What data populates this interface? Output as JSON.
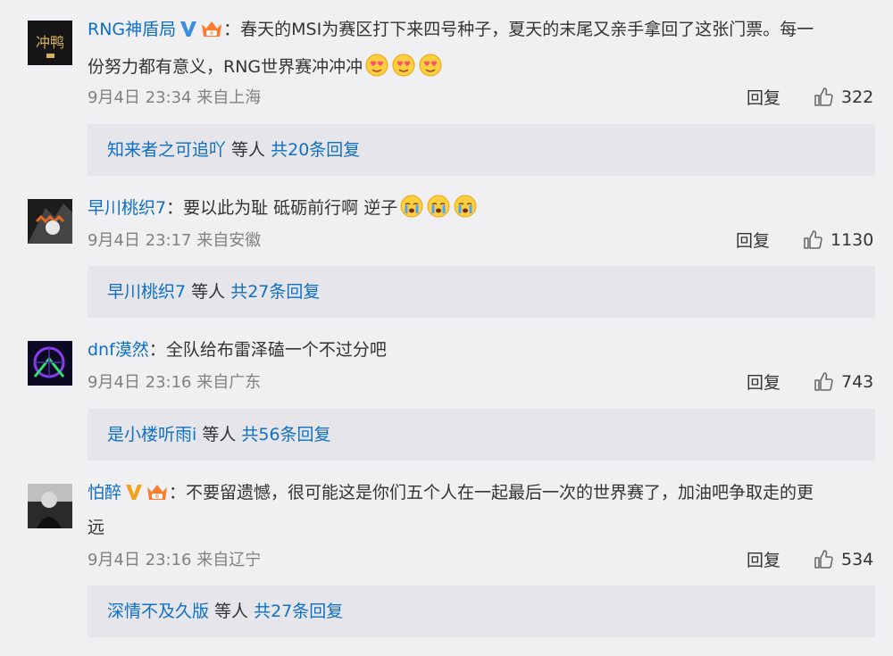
{
  "colors": {
    "link": "#0e6fc4",
    "text": "#333333",
    "meta": "#808080",
    "background": "#f0f0f3",
    "reply_box": "#e6e6ea"
  },
  "comments": [
    {
      "username": "RNG神盾局",
      "badges": [
        "verified-v-blue-icon",
        "crown-badge-icon"
      ],
      "separator": "：",
      "text_line1": "春天的MSI为赛区打下来四号种子，夏天的末尾又亲手拿回了这张门票。每一",
      "text_line2": "份努力都有意义，RNG世界赛冲冲冲",
      "emojis": [
        "heart-eyes-emoji",
        "heart-eyes-emoji",
        "heart-eyes-emoji"
      ],
      "time": "9月4日 23:34 来自上海",
      "reply_label": "回复",
      "likes": "322",
      "reply_user": "知来者之可追吖",
      "reply_mid": " 等人 ",
      "reply_count": "共20条回复"
    },
    {
      "username": "早川桃织7",
      "separator": "：",
      "text_line1": "要以此为耻 砥砺前行啊 逆子",
      "emojis": [
        "crying-emoji",
        "crying-emoji",
        "crying-emoji"
      ],
      "time": "9月4日 23:17 来自安徽",
      "reply_label": "回复",
      "likes": "1130",
      "reply_user": "早川桃织7",
      "reply_mid": " 等人 ",
      "reply_count": "共27条回复"
    },
    {
      "username": "dnf漠然",
      "separator": "：",
      "text_line1": "全队给布雷泽磕一个不过分吧",
      "time": "9月4日 23:16 来自广东",
      "reply_label": "回复",
      "likes": "743",
      "reply_user": "是小楼听雨i",
      "reply_mid": " 等人 ",
      "reply_count": "共56条回复"
    },
    {
      "username": "怕醉",
      "badges": [
        "verified-v-orange-icon",
        "crown-badge-icon"
      ],
      "separator": "：",
      "text_line1": "不要留遗憾，很可能这是你们五个人在一起最后一次的世界赛了，加油吧争取走的更",
      "text_line2": "远",
      "time": "9月4日 23:16 来自辽宁",
      "reply_label": "回复",
      "likes": "534",
      "reply_user": "深情不及久版",
      "reply_mid": " 等人 ",
      "reply_count": "共27条回复"
    }
  ]
}
